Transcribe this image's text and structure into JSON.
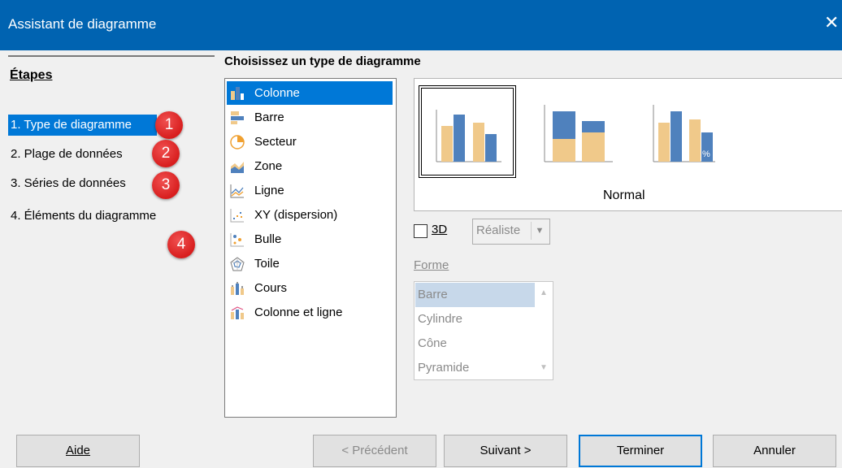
{
  "window": {
    "title": "Assistant de diagramme",
    "close_glyph": "✕"
  },
  "steps": {
    "heading": "Étapes",
    "items": [
      {
        "label": "1. Type de diagramme",
        "badge": "1"
      },
      {
        "label": "2. Plage de données",
        "badge": "2"
      },
      {
        "label": "3. Séries de données",
        "badge": "3"
      },
      {
        "label": "4. Éléments du diagramme",
        "badge": "4"
      }
    ]
  },
  "chart_type": {
    "heading": "Choisissez un type de diagramme",
    "types": [
      {
        "label": "Colonne",
        "icon": "column-chart-icon"
      },
      {
        "label": "Barre",
        "icon": "bar-chart-icon"
      },
      {
        "label": "Secteur",
        "icon": "pie-chart-icon"
      },
      {
        "label": "Zone",
        "icon": "area-chart-icon"
      },
      {
        "label": "Ligne",
        "icon": "line-chart-icon"
      },
      {
        "label": "XY (dispersion)",
        "icon": "scatter-chart-icon"
      },
      {
        "label": "Bulle",
        "icon": "bubble-chart-icon"
      },
      {
        "label": "Toile",
        "icon": "net-chart-icon"
      },
      {
        "label": "Cours",
        "icon": "stock-chart-icon"
      },
      {
        "label": "Colonne et ligne",
        "icon": "column-line-chart-icon"
      }
    ],
    "subtype_label": "Normal",
    "subtype_percent_glyph": "%"
  },
  "options": {
    "label_3d": "3D",
    "shading_value": "Réaliste",
    "shape_label": "Forme",
    "shapes": [
      "Barre",
      "Cylindre",
      "Cône",
      "Pyramide"
    ]
  },
  "buttons": {
    "help": "Aide",
    "back": "< Précédent",
    "next": "Suivant >",
    "finish": "Terminer",
    "cancel": "Annuler"
  },
  "colors": {
    "accent": "#0078d7",
    "titlebar": "#0063b1",
    "bar_blue": "#4f81bd",
    "bar_tan": "#f0c98a",
    "badge_red": "#e02b2b"
  }
}
